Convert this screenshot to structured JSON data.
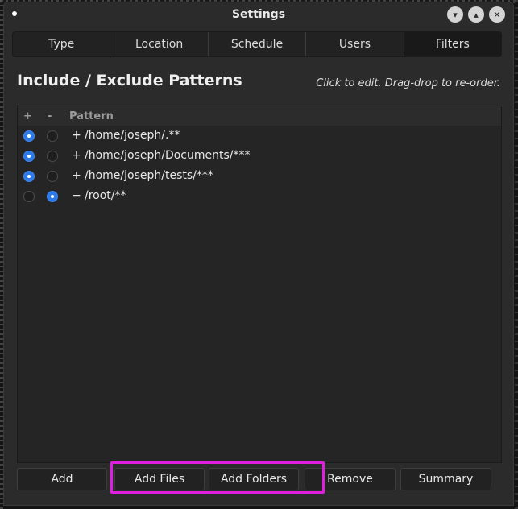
{
  "window": {
    "title": "Settings"
  },
  "titlebar_buttons": [
    {
      "name": "minimize-button",
      "icon": "chevron-down-icon",
      "glyph": "▾"
    },
    {
      "name": "maximize-button",
      "icon": "chevron-up-icon",
      "glyph": "▴"
    },
    {
      "name": "close-button",
      "icon": "close-icon",
      "glyph": "✕"
    }
  ],
  "tabs": [
    {
      "label": "Type",
      "active": false
    },
    {
      "label": "Location",
      "active": false
    },
    {
      "label": "Schedule",
      "active": false
    },
    {
      "label": "Users",
      "active": false
    },
    {
      "label": "Filters",
      "active": true
    }
  ],
  "section": {
    "heading": "Include / Exclude Patterns",
    "hint": "Click to edit. Drag-drop to re-order."
  },
  "table": {
    "columns": {
      "include": "+",
      "exclude": "-",
      "pattern": "Pattern"
    },
    "rows": [
      {
        "include": true,
        "exclude": false,
        "sign": "+",
        "pattern": "/home/joseph/.**"
      },
      {
        "include": true,
        "exclude": false,
        "sign": "+",
        "pattern": "/home/joseph/Documents/***"
      },
      {
        "include": true,
        "exclude": false,
        "sign": "+",
        "pattern": "/home/joseph/tests/***"
      },
      {
        "include": false,
        "exclude": true,
        "sign": "−",
        "pattern": "/root/**"
      }
    ]
  },
  "buttons": {
    "add": "Add",
    "add_files": "Add Files",
    "add_folders": "Add Folders",
    "remove": "Remove",
    "summary": "Summary"
  },
  "colors": {
    "accent": "#2d79e8",
    "highlight": "#e01ee0",
    "window_bg": "#2b2b2b"
  }
}
